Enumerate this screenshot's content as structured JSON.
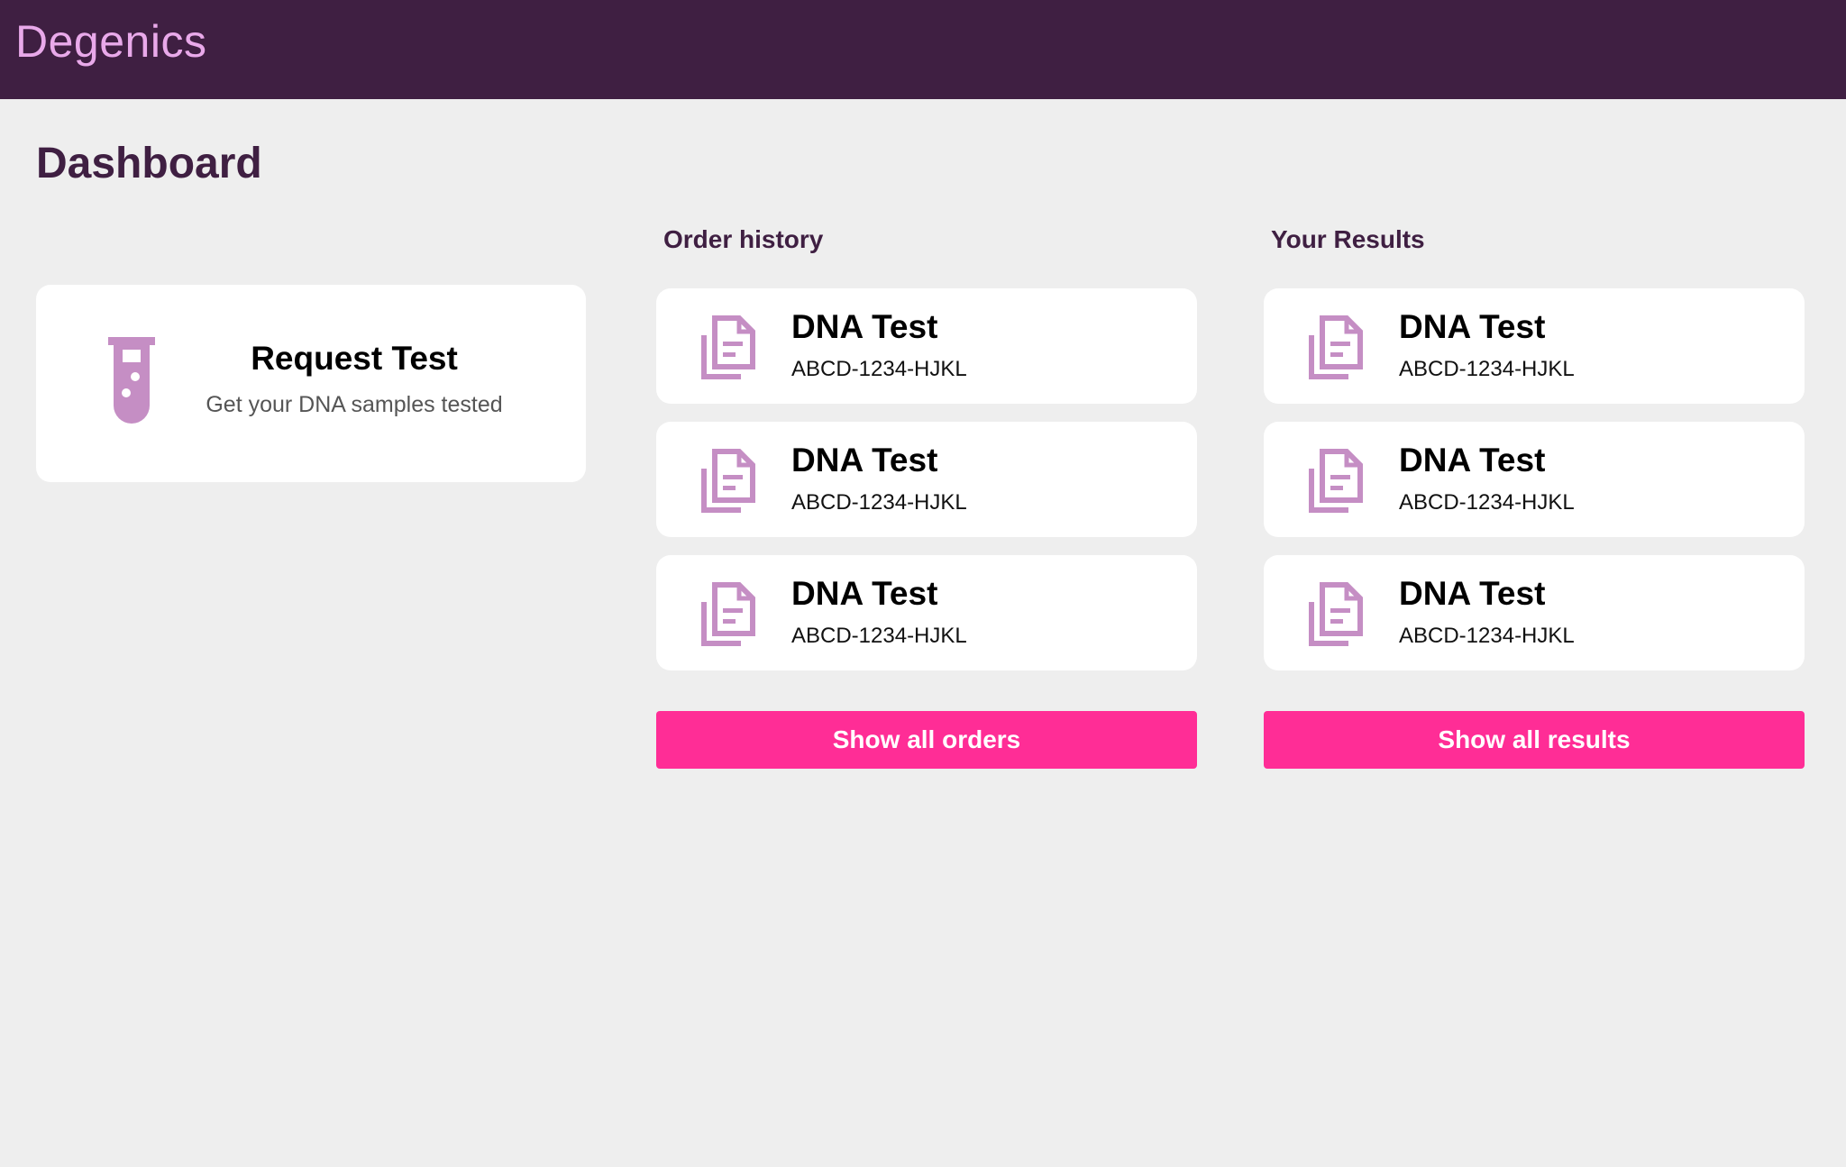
{
  "app": {
    "brand": "Degenics"
  },
  "page": {
    "title": "Dashboard"
  },
  "request_card": {
    "icon": "test-tube-icon",
    "title": "Request Test",
    "subtitle": "Get your DNA samples tested"
  },
  "orders": {
    "heading": "Order history",
    "items": [
      {
        "icon": "document-icon",
        "title": "DNA Test",
        "code": "ABCD-1234-HJKL"
      },
      {
        "icon": "document-icon",
        "title": "DNA Test",
        "code": "ABCD-1234-HJKL"
      },
      {
        "icon": "document-icon",
        "title": "DNA Test",
        "code": "ABCD-1234-HJKL"
      }
    ],
    "button_label": "Show all orders"
  },
  "results": {
    "heading": "Your Results",
    "items": [
      {
        "icon": "document-icon",
        "title": "DNA Test",
        "code": "ABCD-1234-HJKL"
      },
      {
        "icon": "document-icon",
        "title": "DNA Test",
        "code": "ABCD-1234-HJKL"
      },
      {
        "icon": "document-icon",
        "title": "DNA Test",
        "code": "ABCD-1234-HJKL"
      }
    ],
    "button_label": "Show all results"
  },
  "colors": {
    "header_bg": "#3f1f42",
    "brand_text": "#e9a9ea",
    "accent": "#ff2d96",
    "icon": "#c58ec4",
    "background": "#eeeeee"
  }
}
